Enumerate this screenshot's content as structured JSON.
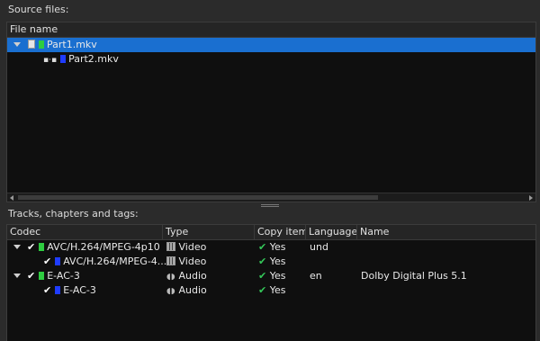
{
  "source_files": {
    "label": "Source files:",
    "column_header": "File name",
    "files": [
      {
        "name": "Part1.mkv",
        "selected": true,
        "color": "#2ecc40"
      },
      {
        "name": "Part2.mkv",
        "selected": false,
        "color": "#1f3cff"
      }
    ]
  },
  "tracks": {
    "label": "Tracks, chapters and tags:",
    "columns": {
      "codec": "Codec",
      "type": "Type",
      "copy": "Copy item",
      "language": "Language",
      "name": "Name"
    },
    "rows": [
      {
        "codec": "AVC/H.264/MPEG-4p10",
        "type": "Video",
        "type_icon": "film-icon",
        "copy": "Yes",
        "language": "und",
        "name": "",
        "color": "#2ecc40"
      },
      {
        "codec": "AVC/H.264/MPEG-4...",
        "type": "Video",
        "type_icon": "film-icon",
        "copy": "Yes",
        "language": "",
        "name": "",
        "color": "#1f3cff"
      },
      {
        "codec": "E-AC-3",
        "type": "Audio",
        "type_icon": "speaker-icon",
        "copy": "Yes",
        "language": "en",
        "name": "Dolby Digital Plus 5.1",
        "color": "#2ecc40"
      },
      {
        "codec": "E-AC-3",
        "type": "Audio",
        "type_icon": "speaker-icon",
        "copy": "Yes",
        "language": "",
        "name": "",
        "color": "#1f3cff"
      }
    ]
  },
  "colors": {
    "background": "#2b2b2b",
    "panel": "#0f0f0f",
    "selection": "#1a6fd0",
    "check_green": "#34c759"
  }
}
